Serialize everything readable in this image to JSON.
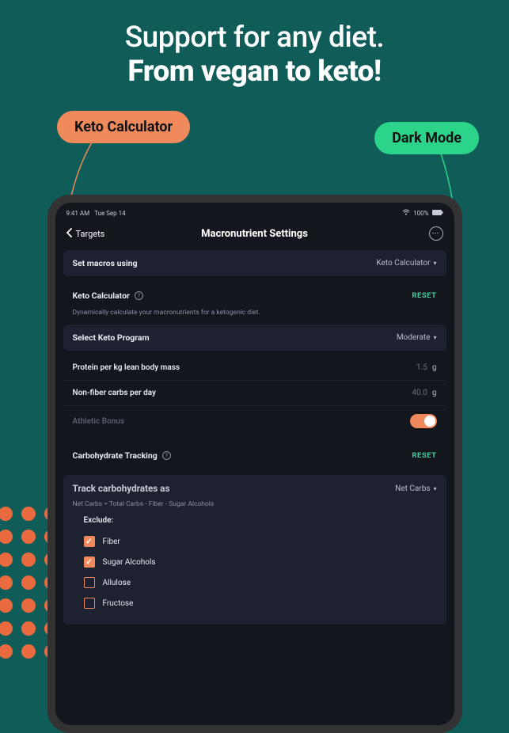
{
  "hero": {
    "line1": "Support for any diet.",
    "line2": "From vegan to keto!"
  },
  "pills": {
    "left_label": "Keto Calculator",
    "right_label": "Dark Mode"
  },
  "status_bar": {
    "time": "9:41 AM",
    "date": "Tue Sep 14",
    "battery": "100%"
  },
  "nav": {
    "back_label": "Targets",
    "title": "Macronutrient Settings"
  },
  "set_macros": {
    "label": "Set macros using",
    "value": "Keto Calculator"
  },
  "keto_calc": {
    "title": "Keto Calculator",
    "subtitle": "Dynamically calculate your macronutrients for a ketogenic diet.",
    "reset_label": "RESET"
  },
  "program": {
    "label": "Select Keto Program",
    "value": "Moderate"
  },
  "protein": {
    "label": "Protein per kg lean body mass",
    "value": "1.5",
    "unit": "g"
  },
  "nonfiber": {
    "label": "Non-fiber carbs per day",
    "value": "40.0",
    "unit": "g"
  },
  "athletic_bonus": {
    "label": "Athletic Bonus"
  },
  "carb_section": {
    "title": "Carbohydrate Tracking",
    "reset_label": "RESET"
  },
  "track_carbs": {
    "label": "Track carbohydrates as",
    "value": "Net Carbs",
    "formula": "Net Carbs = Total Carbs - Fiber - Sugar Alcohols",
    "exclude_title": "Exclude:",
    "items": [
      {
        "label": "Fiber",
        "checked": true
      },
      {
        "label": "Sugar Alcohols",
        "checked": true
      },
      {
        "label": "Allulose",
        "checked": false
      },
      {
        "label": "Fructose",
        "checked": false
      }
    ]
  }
}
